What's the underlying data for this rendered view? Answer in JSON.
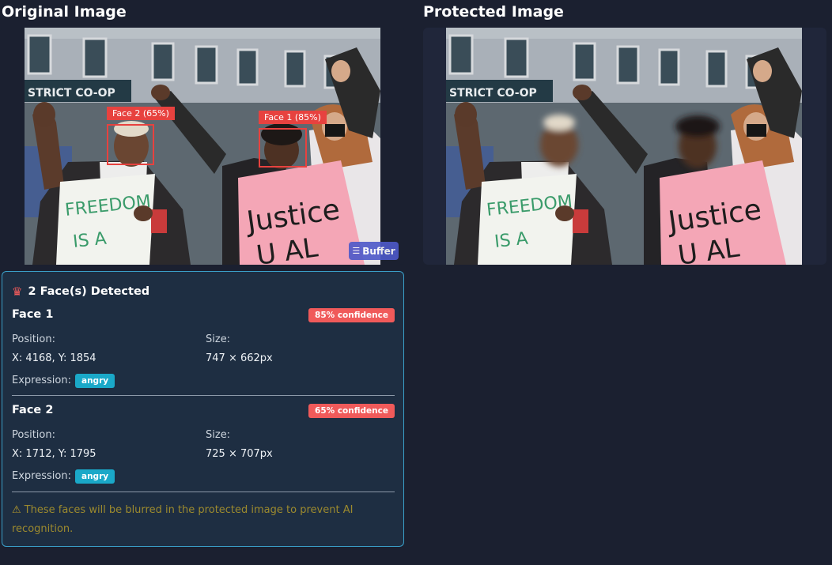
{
  "original": {
    "title": "Original Image"
  },
  "protected": {
    "title": "Protected Image"
  },
  "photo_text": {
    "storefront": "STRICT CO-OP",
    "sign_left": "FREEDOM\nIS A",
    "sign_right": "Justice\nU AL"
  },
  "overlays": [
    {
      "label": "Face 2 (65%)"
    },
    {
      "label": "Face 1 (85%)"
    }
  ],
  "buffer": {
    "icon": "layers-icon",
    "label": "Buffer"
  },
  "panel": {
    "icon": "face-detect-icon",
    "header": "2 Face(s) Detected",
    "faces": [
      {
        "title": "Face 1",
        "confidence": "85% confidence",
        "position_label": "Position:",
        "position": "X: 4168, Y: 1854",
        "size_label": "Size:",
        "size": "747 × 662px",
        "expression_label": "Expression:",
        "expression": "angry"
      },
      {
        "title": "Face 2",
        "confidence": "65% confidence",
        "position_label": "Position:",
        "position": "X: 1712, Y: 1795",
        "size_label": "Size:",
        "size": "725 × 707px",
        "expression_label": "Expression:",
        "expression": "angry"
      }
    ],
    "warning_icon": "warning-icon",
    "warning": "These faces will be blurred in the protected image to prevent AI recognition."
  },
  "colors": {
    "background": "#1b2030",
    "panel_bg": "#1e2e42",
    "panel_border": "#3a9fc8",
    "face_box": "#e7423f",
    "confidence_badge": "#f05a5a",
    "expression_badge": "#1aa8c8",
    "warning_text": "#9c8a2e"
  }
}
